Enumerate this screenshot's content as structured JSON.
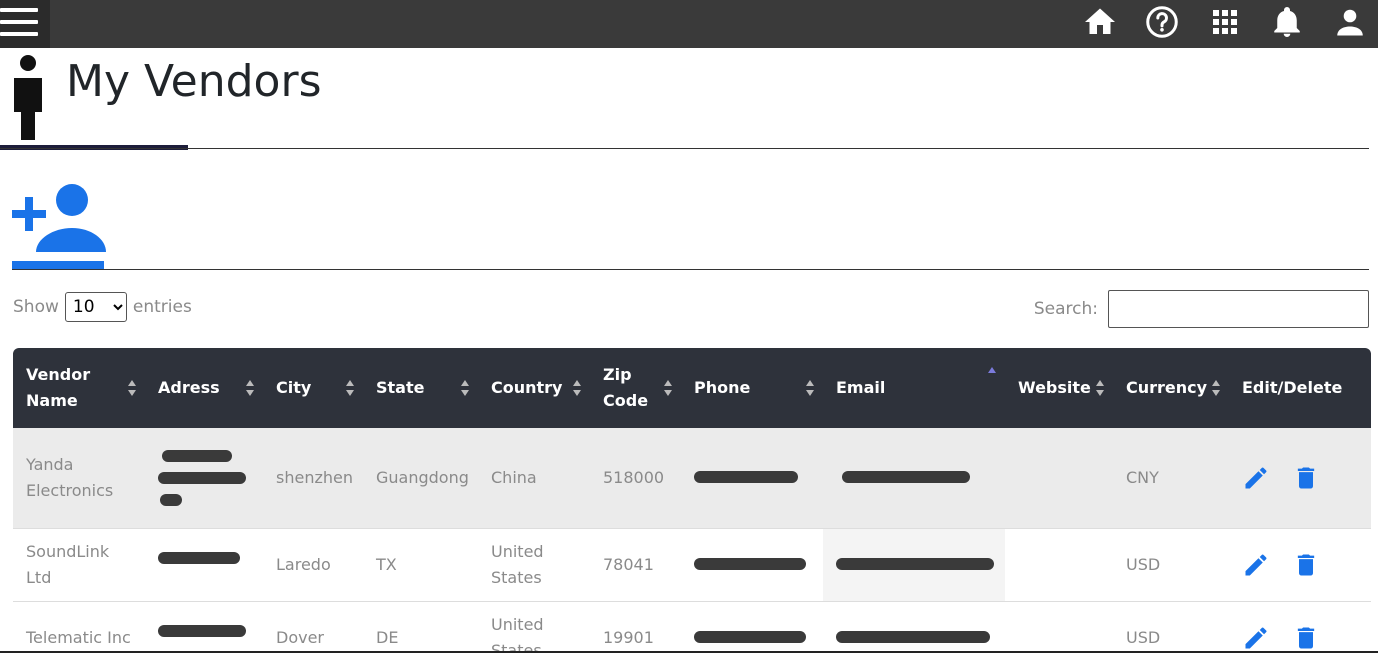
{
  "page": {
    "title": "My Vendors"
  },
  "colors": {
    "accent": "#1a73e8",
    "topbar": "#3a3a3a",
    "table_header": "#2e323b"
  },
  "topbar_icons": [
    "home-icon",
    "help-icon",
    "apps-grid-icon",
    "bell-icon",
    "user-icon"
  ],
  "controls": {
    "show_label": "Show",
    "entries_label": "entries",
    "page_size": "10",
    "page_size_options": [
      "10"
    ],
    "search_label": "Search:",
    "search_value": ""
  },
  "table": {
    "columns": [
      "Vendor Name",
      "Adress",
      "City",
      "State",
      "Country",
      "Zip Code",
      "Phone",
      "Email",
      "Website",
      "Currency",
      "Edit/Delete"
    ],
    "sorted_column": "Email",
    "rows": [
      {
        "vendor_name": "Yanda Electronics",
        "city": "shenzhen",
        "state": "Guangdong",
        "country": "China",
        "zip": "518000",
        "currency": "CNY"
      },
      {
        "vendor_name": "SoundLink Ltd",
        "city": "Laredo",
        "state": "TX",
        "country": "United States",
        "zip": "78041",
        "currency": "USD"
      },
      {
        "vendor_name": "Telematic Inc",
        "city": "Dover",
        "state": "DE",
        "country": "United States",
        "zip": "19901",
        "currency": "USD"
      }
    ]
  }
}
